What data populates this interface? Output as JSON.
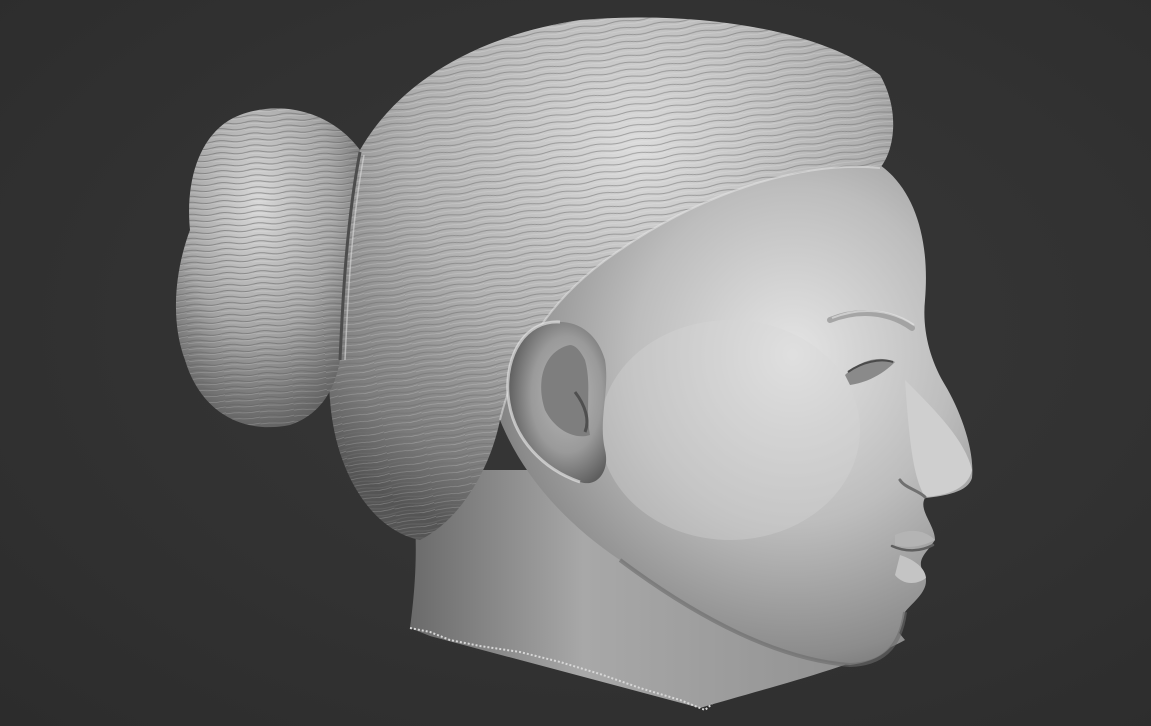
{
  "scene": {
    "subject": "sculpted-head-profile",
    "background_color": "#323232",
    "material_color": "#b9b9b9",
    "shadow_color": "#5a5a5a",
    "highlight_color": "#e6e6e6"
  }
}
